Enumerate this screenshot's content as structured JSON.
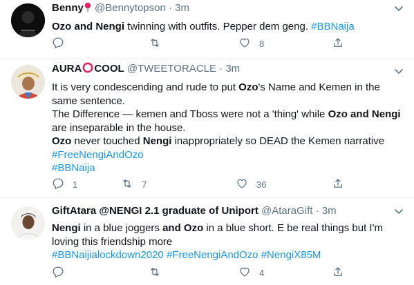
{
  "tweets": [
    {
      "name": "Benny",
      "handle": "@Bennytopson",
      "sep": "·",
      "time": "3m",
      "body": [
        {
          "b": "Ozo and Nengi"
        },
        {
          "t": " twinning with outfits. Pepper dem geng. "
        },
        {
          "h": "#BBNaija"
        }
      ],
      "reply_count": "",
      "retweet_count": "",
      "like_count": "8"
    },
    {
      "name": "AURA",
      "name_suffix": "COOL",
      "handle": "@TWEETORACLE",
      "sep": "·",
      "time": "3m",
      "body": [
        {
          "t": "It is very condescending and rude to put "
        },
        {
          "b": "Ozo"
        },
        {
          "t": "'s Name and Kemen in the same sentence."
        },
        {
          "br": true
        },
        {
          "t": "The Difference — kemen and Tboss were not a 'thing' while "
        },
        {
          "b": "Ozo and Nengi"
        },
        {
          "t": " are inseparable in the house."
        },
        {
          "br": true
        },
        {
          "b": "Ozo"
        },
        {
          "t": " never touched "
        },
        {
          "b": "Nengi"
        },
        {
          "t": " inappropriately so DEAD the Kemen narrative"
        },
        {
          "br": true
        },
        {
          "h": "#FreeNengiAndOzo"
        },
        {
          "br": true
        },
        {
          "h": "#BBNaija"
        }
      ],
      "reply_count": "1",
      "retweet_count": "7",
      "like_count": "36"
    },
    {
      "name": "GiftAtara @NENGI 2.1 graduate of Uniport",
      "handle": "@AtaraGift",
      "sep": "·",
      "time": "3m",
      "body": [
        {
          "b": "Nengi"
        },
        {
          "t": " in a blue joggers "
        },
        {
          "b": "and Ozo"
        },
        {
          "t": " in a blue short. E be real things but I'm loving this friendship more"
        },
        {
          "br": true
        },
        {
          "h": "#BBNaijialockdown2020"
        },
        {
          "t": " "
        },
        {
          "h": "#FreeNengiAndOzo"
        },
        {
          "t": " "
        },
        {
          "h": "#NengiX85M"
        }
      ],
      "reply_count": "",
      "retweet_count": "",
      "like_count": "4"
    }
  ],
  "colors": {
    "hashtag": "#1b95e0",
    "muted": "#5b7083",
    "text": "#0f1419",
    "divider": "#e6ecf0"
  },
  "icons": [
    "more-icon",
    "reply-icon",
    "retweet-icon",
    "like-icon",
    "share-icon"
  ]
}
